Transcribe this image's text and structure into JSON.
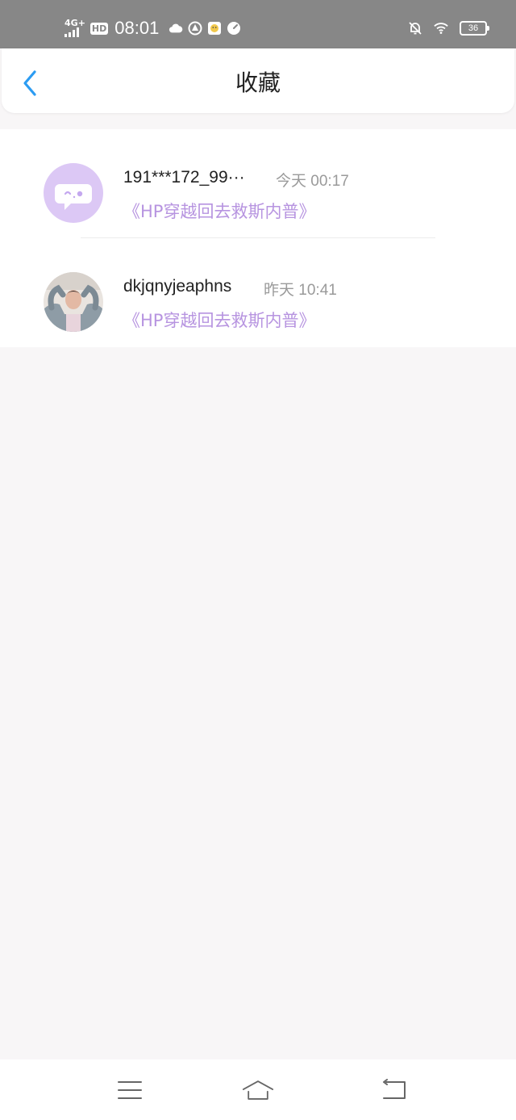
{
  "status_bar": {
    "network": "4G",
    "network_plus": "+",
    "hd": "HD",
    "time": "08:01",
    "battery": "36",
    "icons": [
      "cloud-icon",
      "circle-app-icon",
      "emoji-app-icon",
      "speedometer-icon",
      "mute-bell-icon",
      "wifi-icon",
      "battery-icon"
    ]
  },
  "header": {
    "title": "收藏",
    "back_icon": "chevron-left-icon"
  },
  "favorites": [
    {
      "name": "191***172_99···",
      "time": "今天 00:17",
      "book": "《HP穿越回去救斯内普》",
      "avatar": "default-avatar-icon"
    },
    {
      "name": "dkjqnyjeaphns",
      "time": "昨天 10:41",
      "book": "《HP穿越回去救斯内普》",
      "avatar": "user-photo"
    }
  ],
  "nav_bar": {
    "icons": [
      "menu-icon",
      "home-icon",
      "back-icon"
    ]
  },
  "colors": {
    "status_bar": "#878787",
    "accent_blue": "#2c9cf2",
    "book_purple": "#b794e0",
    "avatar_lavender": "#dcc8f5",
    "page_bg": "#f8f6f7"
  }
}
